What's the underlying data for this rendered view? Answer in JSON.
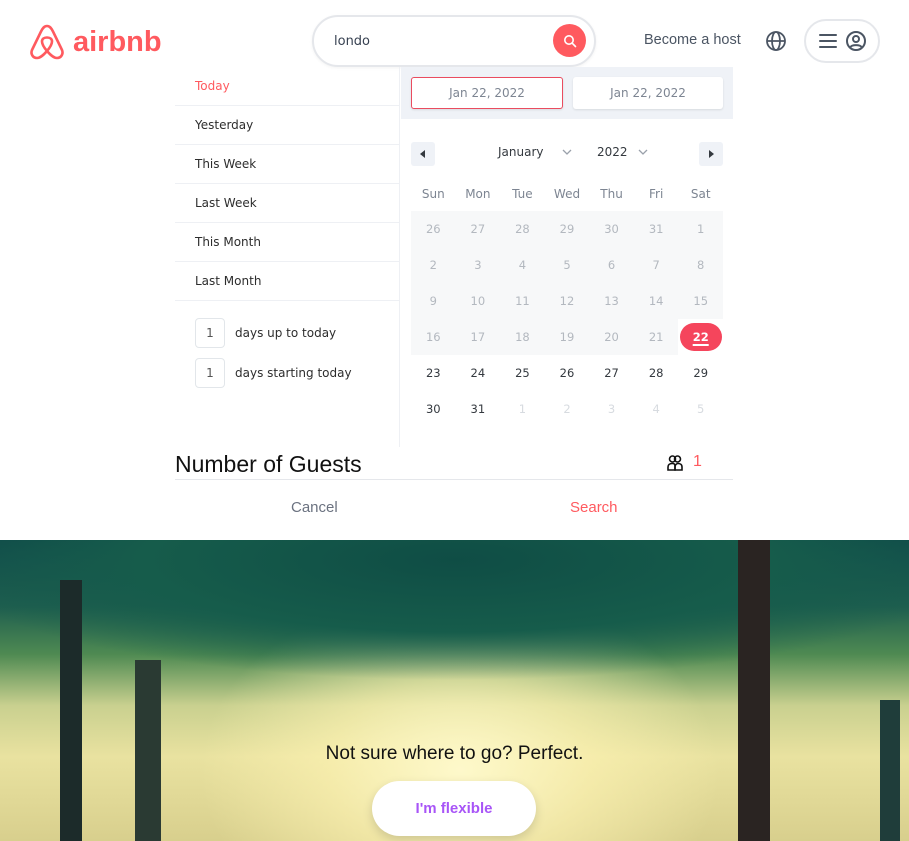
{
  "header": {
    "brand": "airbnb",
    "search": {
      "value": "londo",
      "placeholder": ""
    },
    "become_host": "Become a host",
    "icons": {
      "logo": "airbnb-belo-icon",
      "search": "search-icon",
      "globe": "globe-icon",
      "menu": "hamburger-icon",
      "user": "user-circle-icon"
    }
  },
  "colors": {
    "brand": "#ff5a5f",
    "selected_day": "#f5455c",
    "flexible": "#a855f7"
  },
  "date_picker": {
    "ranges": [
      {
        "label": "Today",
        "active": true
      },
      {
        "label": "Yesterday",
        "active": false
      },
      {
        "label": "This Week",
        "active": false
      },
      {
        "label": "Last Week",
        "active": false
      },
      {
        "label": "This Month",
        "active": false
      },
      {
        "label": "Last Month",
        "active": false
      }
    ],
    "days_up_to_today": {
      "value": "1",
      "label": "days up to today"
    },
    "days_starting_today": {
      "value": "1",
      "label": "days starting today"
    },
    "start_date": "Jan 22, 2022",
    "end_date": "Jan 22, 2022",
    "month": "January",
    "year": "2022",
    "weekdays": [
      "Sun",
      "Mon",
      "Tue",
      "Wed",
      "Thu",
      "Fri",
      "Sat"
    ],
    "days": [
      {
        "d": "26",
        "s": "past"
      },
      {
        "d": "27",
        "s": "past"
      },
      {
        "d": "28",
        "s": "past"
      },
      {
        "d": "29",
        "s": "past"
      },
      {
        "d": "30",
        "s": "past"
      },
      {
        "d": "31",
        "s": "past"
      },
      {
        "d": "1",
        "s": "past"
      },
      {
        "d": "2",
        "s": "past"
      },
      {
        "d": "3",
        "s": "past"
      },
      {
        "d": "4",
        "s": "past"
      },
      {
        "d": "5",
        "s": "past"
      },
      {
        "d": "6",
        "s": "past"
      },
      {
        "d": "7",
        "s": "past"
      },
      {
        "d": "8",
        "s": "past"
      },
      {
        "d": "9",
        "s": "past"
      },
      {
        "d": "10",
        "s": "past"
      },
      {
        "d": "11",
        "s": "past"
      },
      {
        "d": "12",
        "s": "past"
      },
      {
        "d": "13",
        "s": "past"
      },
      {
        "d": "14",
        "s": "past"
      },
      {
        "d": "15",
        "s": "past"
      },
      {
        "d": "16",
        "s": "past"
      },
      {
        "d": "17",
        "s": "past"
      },
      {
        "d": "18",
        "s": "past"
      },
      {
        "d": "19",
        "s": "past"
      },
      {
        "d": "20",
        "s": "past"
      },
      {
        "d": "21",
        "s": "past"
      },
      {
        "d": "22",
        "s": "sel"
      },
      {
        "d": "23",
        "s": "cur"
      },
      {
        "d": "24",
        "s": "cur"
      },
      {
        "d": "25",
        "s": "cur"
      },
      {
        "d": "26",
        "s": "cur"
      },
      {
        "d": "27",
        "s": "cur"
      },
      {
        "d": "28",
        "s": "cur"
      },
      {
        "d": "29",
        "s": "cur"
      },
      {
        "d": "30",
        "s": "cur"
      },
      {
        "d": "31",
        "s": "cur"
      },
      {
        "d": "1",
        "s": "next"
      },
      {
        "d": "2",
        "s": "next"
      },
      {
        "d": "3",
        "s": "next"
      },
      {
        "d": "4",
        "s": "next"
      },
      {
        "d": "5",
        "s": "next"
      }
    ]
  },
  "guests": {
    "title": "Number of Guests",
    "count": "1",
    "icon": "users-icon"
  },
  "actions": {
    "cancel": "Cancel",
    "search": "Search"
  },
  "hero": {
    "tagline": "Not sure where to go? Perfect.",
    "button": "I'm flexible"
  }
}
